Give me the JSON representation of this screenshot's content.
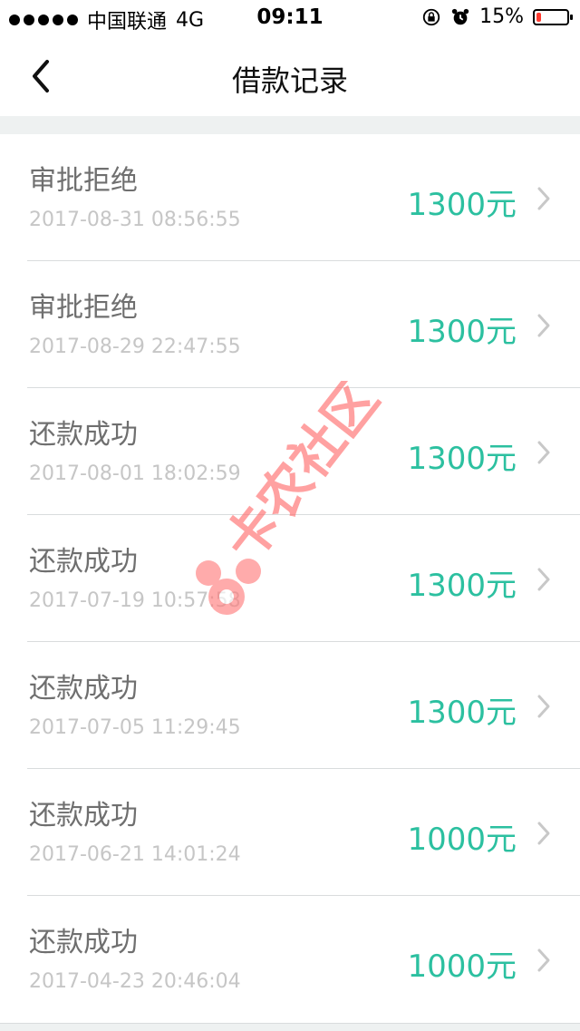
{
  "status_bar": {
    "carrier": "中国联通",
    "network": "4G",
    "time": "09:11",
    "battery_percent": "15%",
    "battery_level_fraction": 0.15,
    "icons": [
      "orientation-lock-icon",
      "alarm-icon",
      "battery-icon"
    ]
  },
  "header": {
    "title": "借款记录",
    "back_icon": "chevron-left-icon"
  },
  "records": [
    {
      "status": "审批拒绝",
      "time": "2017-08-31 08:56:55",
      "amount": "1300元"
    },
    {
      "status": "审批拒绝",
      "time": "2017-08-29 22:47:55",
      "amount": "1300元"
    },
    {
      "status": "还款成功",
      "time": "2017-08-01 18:02:59",
      "amount": "1300元"
    },
    {
      "status": "还款成功",
      "time": "2017-07-19 10:57:58",
      "amount": "1300元"
    },
    {
      "status": "还款成功",
      "time": "2017-07-05 11:29:45",
      "amount": "1300元"
    },
    {
      "status": "还款成功",
      "time": "2017-06-21 14:01:24",
      "amount": "1000元"
    },
    {
      "status": "还款成功",
      "time": "2017-04-23 20:46:04",
      "amount": "1000元"
    }
  ],
  "watermark": {
    "text": "卡农社区",
    "color": "#ff6f6f"
  },
  "colors": {
    "accent": "#2cc0a0",
    "muted_text": "#6f6f6f",
    "timestamp_text": "#c6c6c6",
    "section_bg": "#eef1f1"
  }
}
